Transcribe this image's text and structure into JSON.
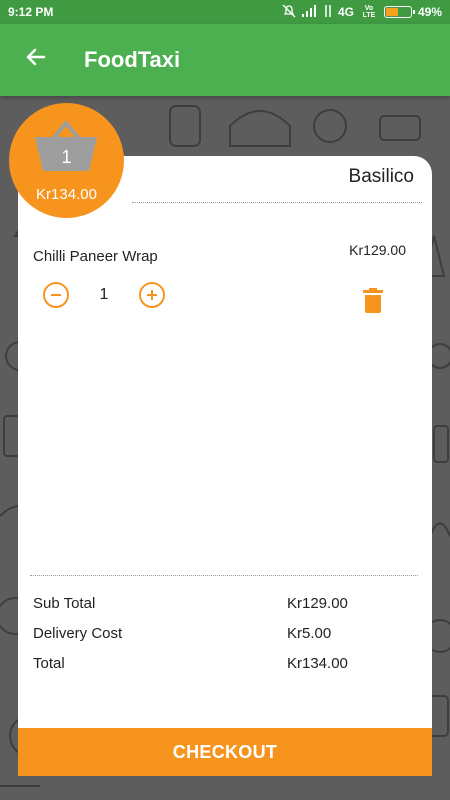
{
  "status_bar": {
    "time": "9:12 PM",
    "network": "4G",
    "volte": "Vo LTE",
    "battery": "49%",
    "battery_level": 0.49
  },
  "app_bar": {
    "title": "FoodTaxi",
    "back_icon": "arrow-left-icon"
  },
  "basket": {
    "count": "1",
    "total": "Kr134.00",
    "icon": "basket-icon"
  },
  "restaurant": {
    "name": "Basilico"
  },
  "items": [
    {
      "name": "Chilli Paneer Wrap",
      "price": "Kr129.00",
      "quantity": "1",
      "minus_icon": "minus-circle-icon",
      "plus_icon": "plus-circle-icon",
      "delete_icon": "trash-icon"
    }
  ],
  "summary": {
    "subtotal_label": "Sub Total",
    "subtotal_value": "Kr129.00",
    "delivery_label": "Delivery Cost",
    "delivery_value": "Kr5.00",
    "total_label": "Total",
    "total_value": "Kr134.00"
  },
  "checkout": {
    "label": "CHECKOUT"
  },
  "colors": {
    "status_bar": "#3f9a42",
    "app_bar": "#4caf50",
    "accent": "#f7941d",
    "card": "#ffffff",
    "background": "#5d5d5d"
  }
}
